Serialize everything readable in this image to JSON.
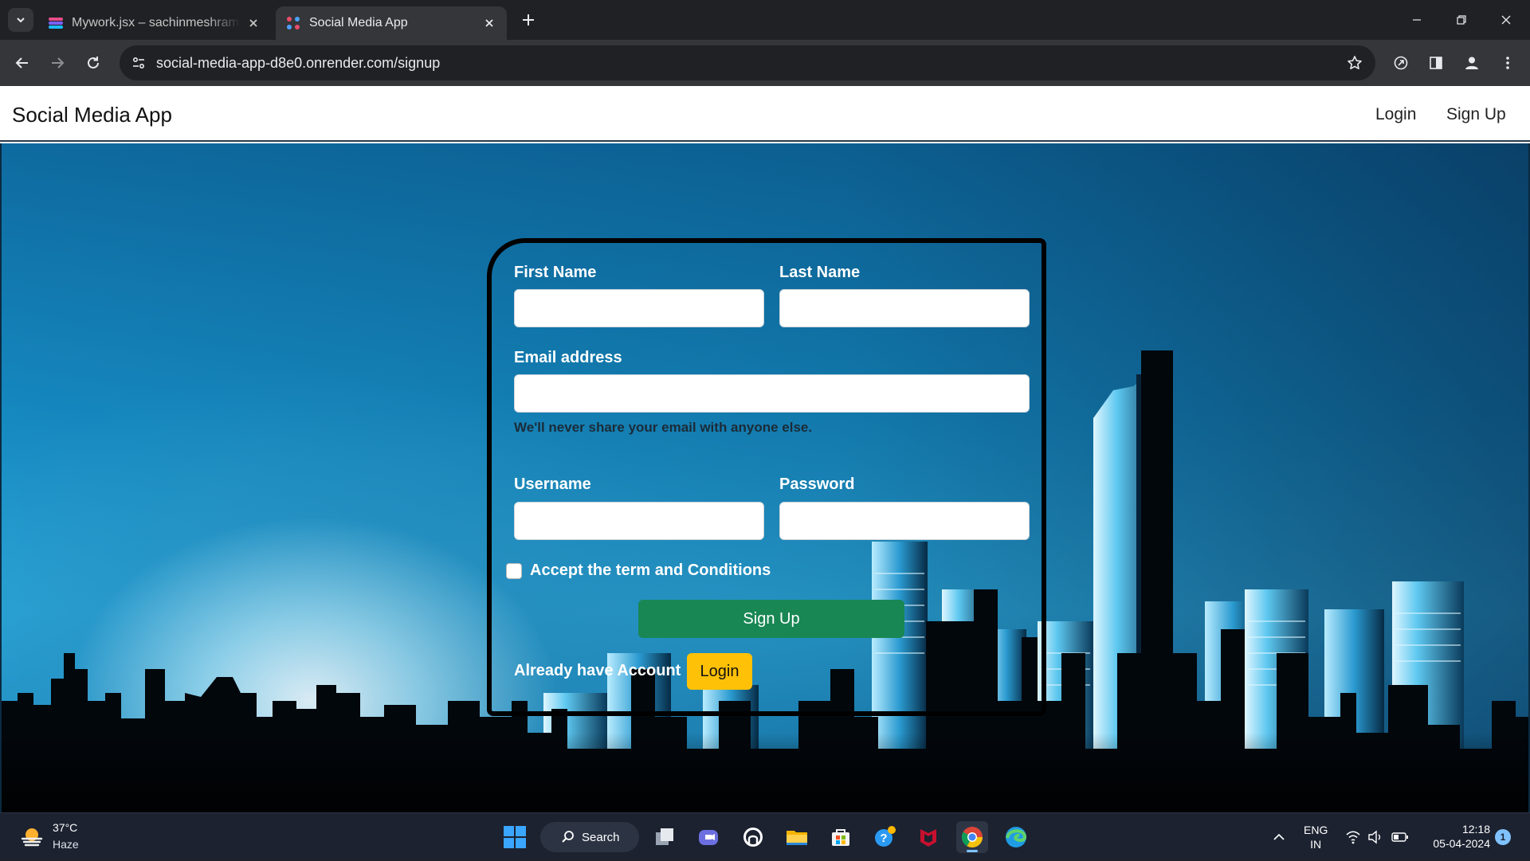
{
  "browser": {
    "tabs": [
      {
        "title": "Mywork.jsx – sachinmeshrampo",
        "active": false
      },
      {
        "title": "Social Media App",
        "active": true
      }
    ],
    "url": "social-media-app-d8e0.onrender.com/signup"
  },
  "navbar": {
    "brand": "Social Media App",
    "login_label": "Login",
    "signup_label": "Sign Up"
  },
  "form": {
    "first_name_label": "First Name",
    "first_name_value": "",
    "last_name_label": "Last Name",
    "last_name_value": "",
    "email_label": "Email address",
    "email_value": "",
    "email_help": "We'll never share your email with anyone else.",
    "username_label": "Username",
    "username_value": "",
    "password_label": "Password",
    "password_value": "",
    "terms_label": "Accept the term and Conditions",
    "terms_checked": false,
    "signup_button": "Sign Up",
    "already_text": "Already have Account",
    "login_button": "Login"
  },
  "colors": {
    "signup_button": "#198754",
    "login_button": "#ffc107",
    "hero_blue": "#1588bf"
  },
  "taskbar": {
    "weather_temp": "37°C",
    "weather_desc": "Haze",
    "search_label": "Search",
    "apps": [
      "start-icon",
      "search-icon",
      "task-view-icon",
      "teams-icon",
      "github-icon",
      "file-explorer-icon",
      "store-icon",
      "help-icon",
      "mcafee-icon",
      "chrome-icon",
      "edge-icon"
    ],
    "lang_line1": "ENG",
    "lang_line2": "IN",
    "time": "12:18",
    "date": "05-04-2024",
    "notification_count": "1"
  }
}
